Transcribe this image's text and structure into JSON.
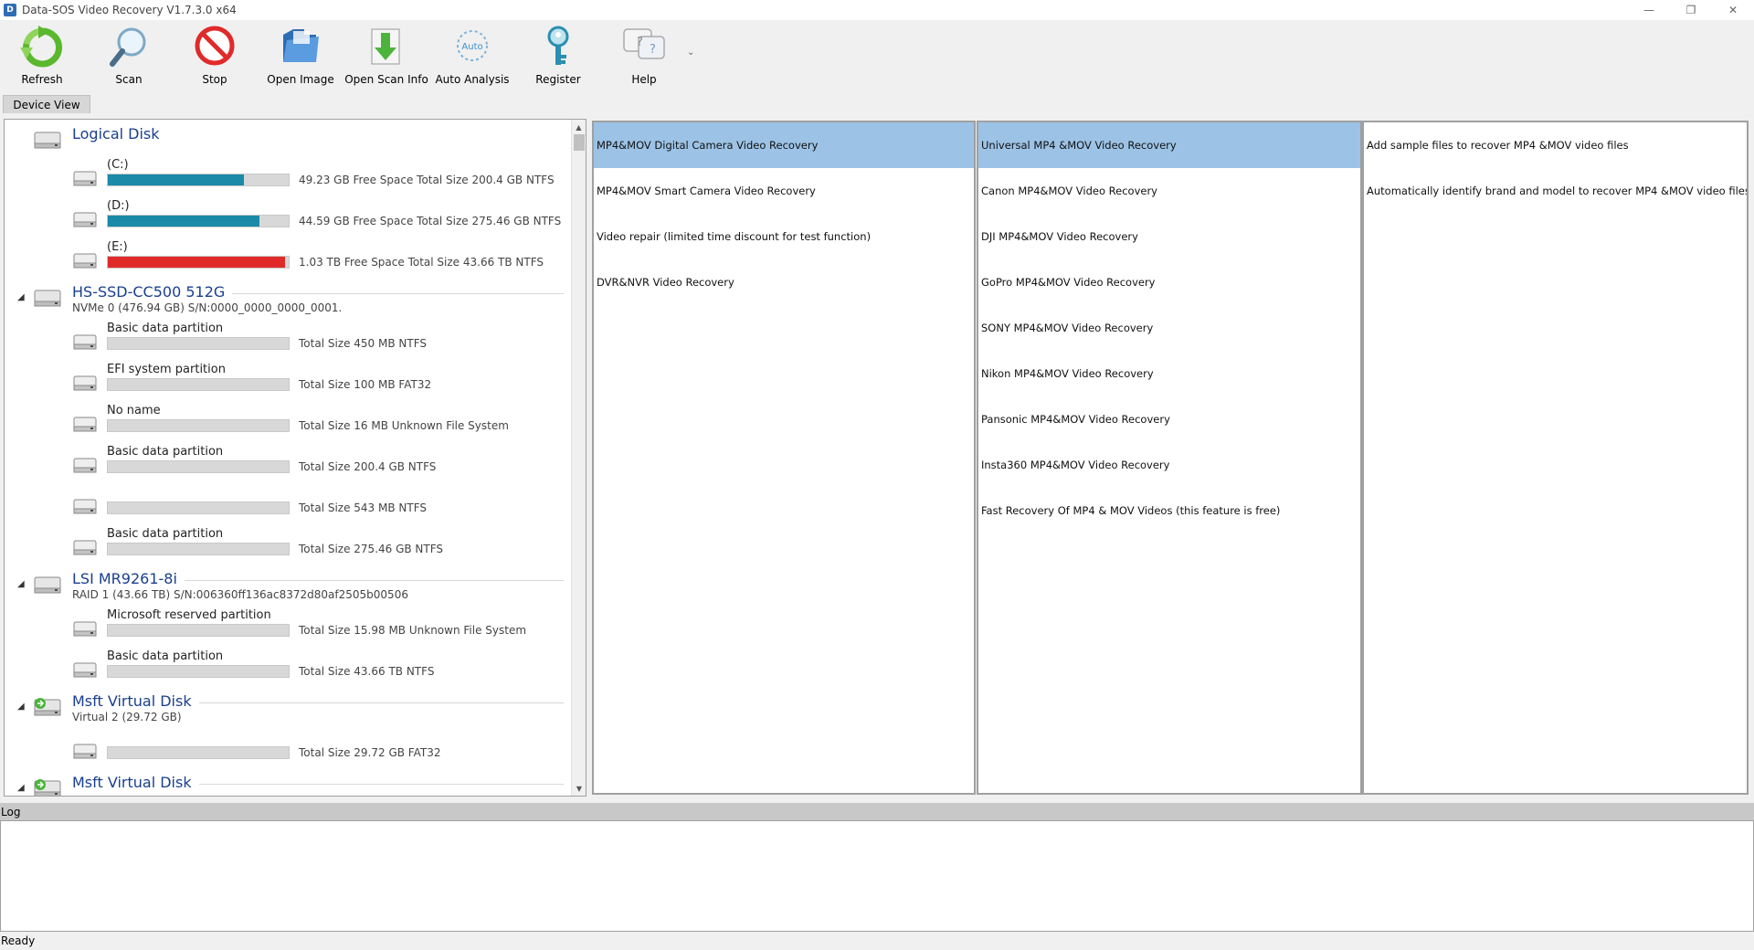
{
  "window": {
    "title": "Data-SOS Video Recovery V1.7.3.0 x64",
    "minimize": "—",
    "restore": "❐",
    "close": "✕"
  },
  "toolbar": {
    "refresh": "Refresh",
    "scan": "Scan",
    "stop": "Stop",
    "open_image": "Open Image",
    "open_scan_info": "Open Scan Info",
    "auto_analysis": "Auto Analysis",
    "auto_icon_text": "Auto",
    "register": "Register",
    "help": "Help",
    "more": "⌄"
  },
  "tabs": {
    "device_view": "Device View"
  },
  "colors": {
    "bar_blue": "#1a8aa8",
    "bar_red": "#e02a2a",
    "bar_empty": "#d8d8d8",
    "selected": "#9cc3e6",
    "disk_name": "#1a3f8f"
  },
  "disks": [
    {
      "name": "Logical Disk",
      "sub": "",
      "partitions": [
        {
          "name": "(C:)",
          "info": "49.23 GB Free Space Total Size 200.4 GB NTFS",
          "used": 0.75,
          "color": "#1a8aa8"
        },
        {
          "name": "(D:)",
          "info": "44.59 GB Free Space Total Size 275.46 GB NTFS",
          "used": 0.84,
          "color": "#1a8aa8"
        },
        {
          "name": "(E:)",
          "info": "1.03 TB Free Space Total Size 43.66 TB NTFS",
          "used": 0.98,
          "color": "#e02a2a"
        }
      ]
    },
    {
      "name": "HS-SSD-CC500 512G",
      "sub": "NVMe 0 (476.94 GB) S/N:0000_0000_0000_0001.",
      "partitions": [
        {
          "name": "Basic data partition",
          "info": "Total Size 450 MB NTFS"
        },
        {
          "name": "EFI system partition",
          "info": "Total Size 100 MB FAT32"
        },
        {
          "name": "No name",
          "info": "Total Size 16 MB Unknown File System"
        },
        {
          "name": "Basic data partition",
          "info": "Total Size 200.4 GB NTFS"
        },
        {
          "name": "",
          "info": "Total Size 543 MB NTFS"
        },
        {
          "name": "Basic data partition",
          "info": "Total Size 275.46 GB NTFS"
        }
      ]
    },
    {
      "name": "LSI MR9261-8i",
      "sub": "RAID 1 (43.66 TB) S/N:006360ff136ac8372d80af2505b00506",
      "partitions": [
        {
          "name": "Microsoft reserved partition",
          "info": "Total Size 15.98 MB Unknown File System"
        },
        {
          "name": "Basic data partition",
          "info": "Total Size 43.66 TB NTFS"
        }
      ]
    },
    {
      "name": "Msft Virtual Disk",
      "sub": "Virtual 2 (29.72 GB)",
      "partitions": [
        {
          "name": "",
          "info": "Total Size 29.72 GB FAT32"
        }
      ]
    },
    {
      "name": "Msft Virtual Disk",
      "sub": "",
      "partitions": []
    }
  ],
  "panels": {
    "recovery_types": [
      "MP4&MOV Digital Camera Video Recovery",
      "MP4&MOV Smart Camera  Video Recovery",
      "Video repair (limited time discount for test function)",
      "DVR&NVR Video Recovery"
    ],
    "brands": [
      "Universal MP4 &MOV Video Recovery",
      "Canon MP4&MOV Video Recovery",
      "DJI MP4&MOV Video Recovery",
      "GoPro MP4&MOV Video Recovery",
      "SONY MP4&MOV Video Recovery",
      "Nikon MP4&MOV Video Recovery",
      "Pansonic MP4&MOV Video Recovery",
      "Insta360 MP4&MOV Video Recovery",
      "Fast Recovery Of MP4 & MOV Videos (this feature is free)"
    ],
    "descriptions": [
      "Add sample files to recover MP4 &MOV video files",
      "Automatically identify brand and model to recover MP4 &MOV video files"
    ]
  },
  "log": {
    "title": "Log"
  },
  "status": {
    "text": "Ready"
  }
}
